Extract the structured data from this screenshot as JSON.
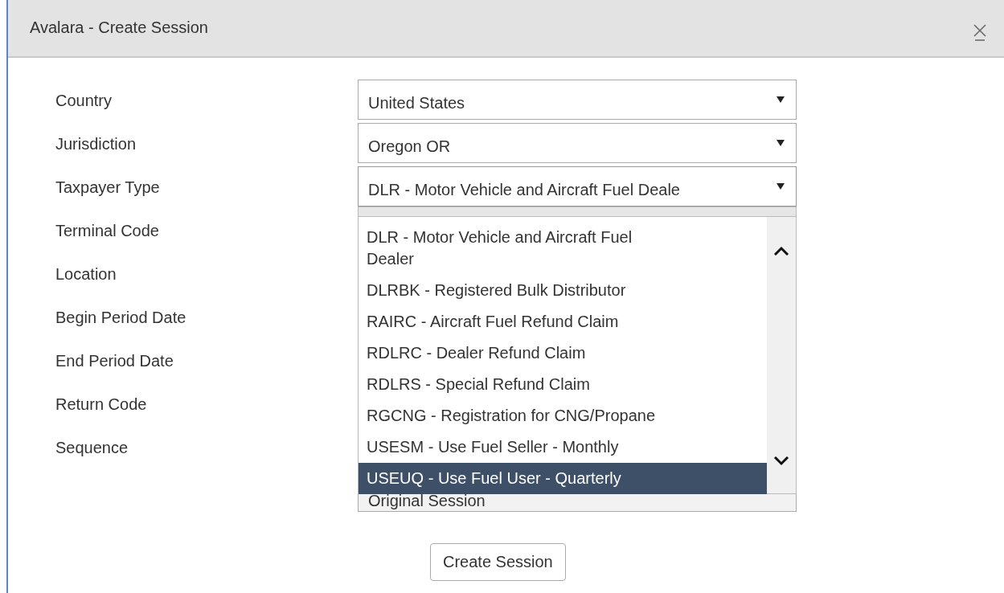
{
  "window": {
    "title": "Avalara - Create Session"
  },
  "fields": [
    {
      "label": "Country",
      "value": "United States",
      "open": false
    },
    {
      "label": "Jurisdiction",
      "value": "Oregon OR",
      "open": false
    },
    {
      "label": "Taxpayer Type",
      "value": "DLR - Motor Vehicle and Aircraft Fuel Deale",
      "open": true
    },
    {
      "label": "Terminal Code"
    },
    {
      "label": "Location"
    },
    {
      "label": "Begin Period Date"
    },
    {
      "label": "End Period Date"
    },
    {
      "label": "Return Code"
    },
    {
      "label": "Sequence"
    }
  ],
  "dropdown": {
    "items": [
      {
        "label": "DLR - Motor Vehicle and Aircraft Fuel Dealer",
        "selected": false
      },
      {
        "label": "DLRBK - Registered Bulk Distributor",
        "selected": false
      },
      {
        "label": "RAIRC - Aircraft Fuel Refund Claim",
        "selected": false
      },
      {
        "label": "RDLRC - Dealer Refund Claim",
        "selected": false
      },
      {
        "label": "RDLRS - Special Refund Claim",
        "selected": false
      },
      {
        "label": "RGCNG - Registration for CNG/Propane",
        "selected": false
      },
      {
        "label": "USESM - Use Fuel Seller - Monthly",
        "selected": false
      },
      {
        "label": "USEUQ - Use Fuel User - Quarterly",
        "selected": true
      }
    ]
  },
  "partly_covered_field": {
    "value": "Original Session"
  },
  "create_button": {
    "label": "Create Session"
  }
}
